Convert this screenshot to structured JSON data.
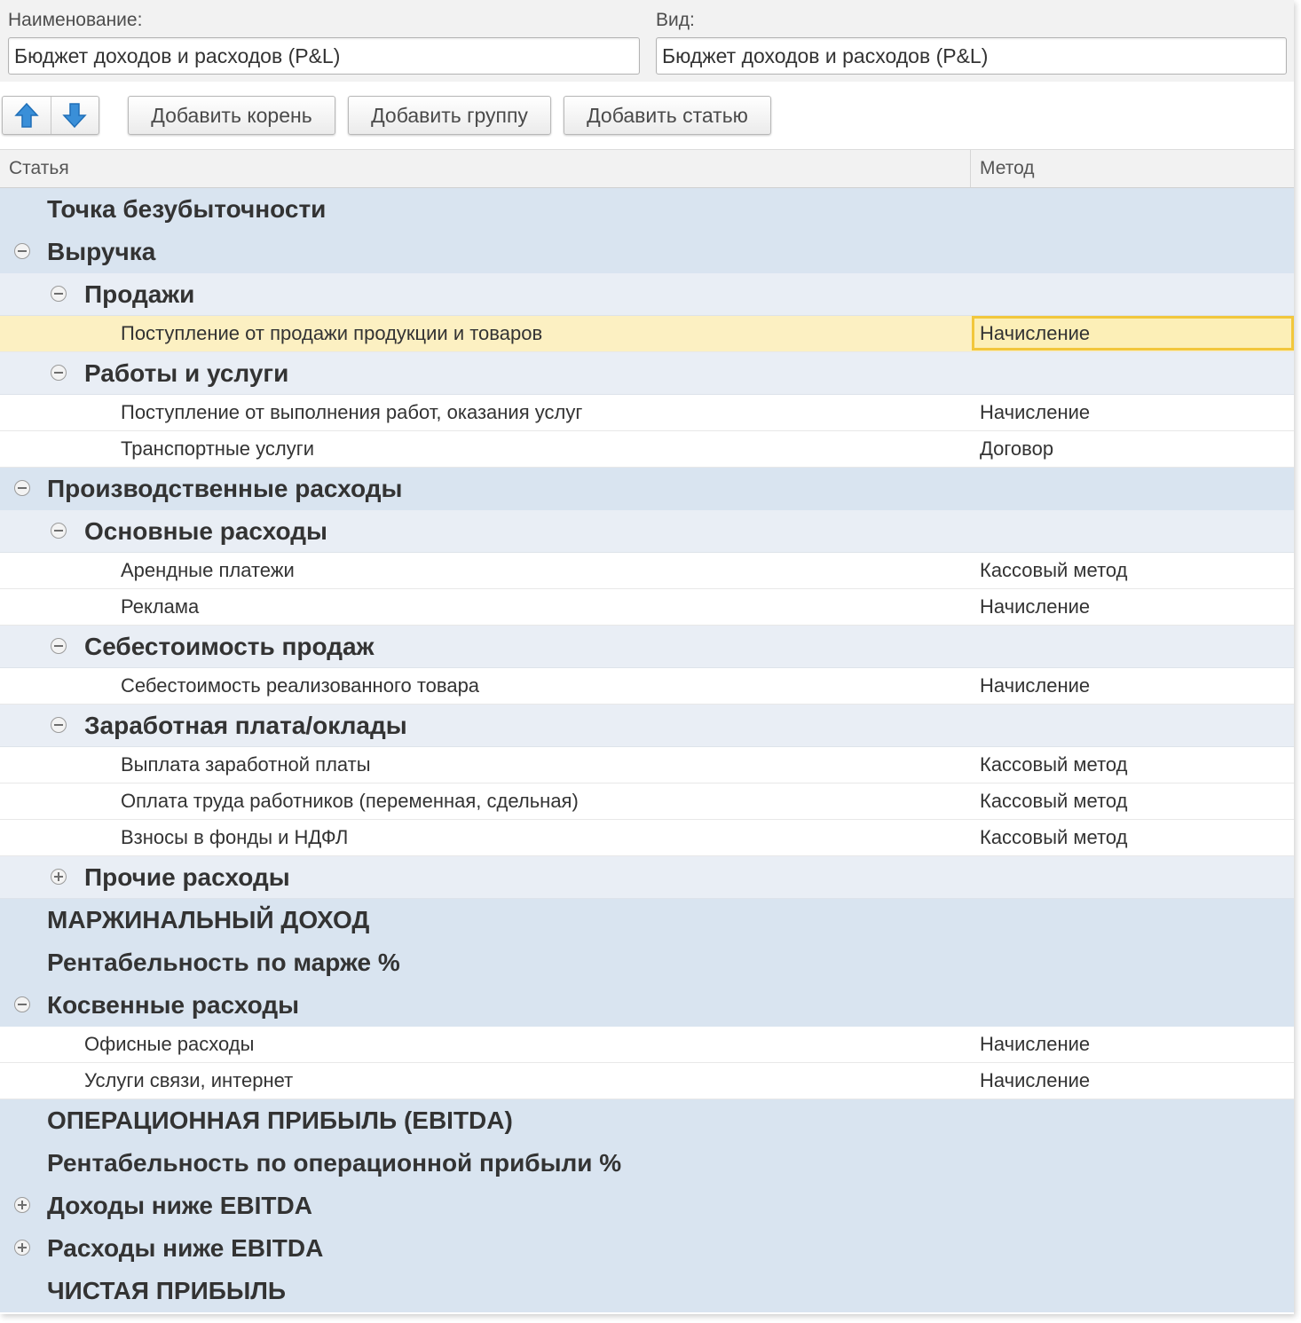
{
  "form": {
    "name_label": "Наименование:",
    "name_value": "Бюджет доходов и расходов (P&L)",
    "kind_label": "Вид:",
    "kind_value": "Бюджет доходов и расходов (P&L)"
  },
  "toolbar": {
    "move_up_icon": "arrow-up-icon",
    "move_down_icon": "arrow-down-icon",
    "add_root_label": "Добавить корень",
    "add_group_label": "Добавить группу",
    "add_item_label": "Добавить статью"
  },
  "table": {
    "col_item": "Статья",
    "col_method": "Метод",
    "rows": [
      {
        "kind": "g0",
        "toggle": "none",
        "label": "Точка безубыточности",
        "method": ""
      },
      {
        "kind": "g0",
        "toggle": "minus",
        "label": "Выручка",
        "method": ""
      },
      {
        "kind": "g1",
        "toggle": "minus",
        "label": "Продажи",
        "method": ""
      },
      {
        "kind": "leaf",
        "label": "Поступление от продажи продукции и товаров",
        "method": "Начисление",
        "selected": true
      },
      {
        "kind": "g1",
        "toggle": "minus",
        "label": "Работы и услуги",
        "method": ""
      },
      {
        "kind": "leaf",
        "label": "Поступление от выполнения работ, оказания услуг",
        "method": "Начисление"
      },
      {
        "kind": "leaf",
        "label": "Транспортные услуги",
        "method": "Договор"
      },
      {
        "kind": "g0",
        "toggle": "minus",
        "label": "Производственные расходы",
        "method": ""
      },
      {
        "kind": "g1",
        "toggle": "minus",
        "label": "Основные расходы",
        "method": ""
      },
      {
        "kind": "leaf",
        "label": "Арендные платежи",
        "method": "Кассовый метод"
      },
      {
        "kind": "leaf",
        "label": "Реклама",
        "method": "Начисление"
      },
      {
        "kind": "g1",
        "toggle": "minus",
        "label": "Себестоимость продаж",
        "method": ""
      },
      {
        "kind": "leaf",
        "label": "Себестоимость реализованного товара",
        "method": "Начисление"
      },
      {
        "kind": "g1",
        "toggle": "minus",
        "label": "Заработная плата/оклады",
        "method": ""
      },
      {
        "kind": "leaf",
        "label": "Выплата заработной платы",
        "method": "Кассовый метод"
      },
      {
        "kind": "leaf",
        "label": "Оплата труда работников (переменная, сдельная)",
        "method": "Кассовый метод"
      },
      {
        "kind": "leaf",
        "label": "Взносы в фонды и НДФЛ",
        "method": "Кассовый метод"
      },
      {
        "kind": "g1",
        "toggle": "plus",
        "label": "Прочие расходы",
        "method": ""
      },
      {
        "kind": "g0",
        "toggle": "none",
        "label": "МАРЖИНАЛЬНЫЙ ДОХОД",
        "method": ""
      },
      {
        "kind": "g0",
        "toggle": "none",
        "label": "Рентабельность по марже %",
        "method": ""
      },
      {
        "kind": "g0",
        "toggle": "minus",
        "label": "Косвенные расходы",
        "method": ""
      },
      {
        "kind": "leaf1",
        "label": "Офисные расходы",
        "method": "Начисление"
      },
      {
        "kind": "leaf1",
        "label": "Услуги связи, интернет",
        "method": "Начисление"
      },
      {
        "kind": "g0",
        "toggle": "none",
        "label": "ОПЕРАЦИОННАЯ ПРИБЫЛЬ (EBITDA)",
        "method": ""
      },
      {
        "kind": "g0",
        "toggle": "none",
        "label": "Рентабельность по операционной прибыли %",
        "method": ""
      },
      {
        "kind": "g0",
        "toggle": "plus",
        "label": "Доходы ниже EBITDA",
        "method": ""
      },
      {
        "kind": "g0",
        "toggle": "plus",
        "label": "Расходы ниже EBITDA",
        "method": ""
      },
      {
        "kind": "g0",
        "toggle": "none",
        "label": "ЧИСТАЯ ПРИБЫЛЬ",
        "method": ""
      }
    ]
  },
  "colors": {
    "root_row": "#d9e4f0",
    "group_row": "#e9eef5",
    "selected_row": "#fcf0c2",
    "selected_cell_border": "#f2c73c",
    "arrow_blue": "#3a8fd8"
  }
}
